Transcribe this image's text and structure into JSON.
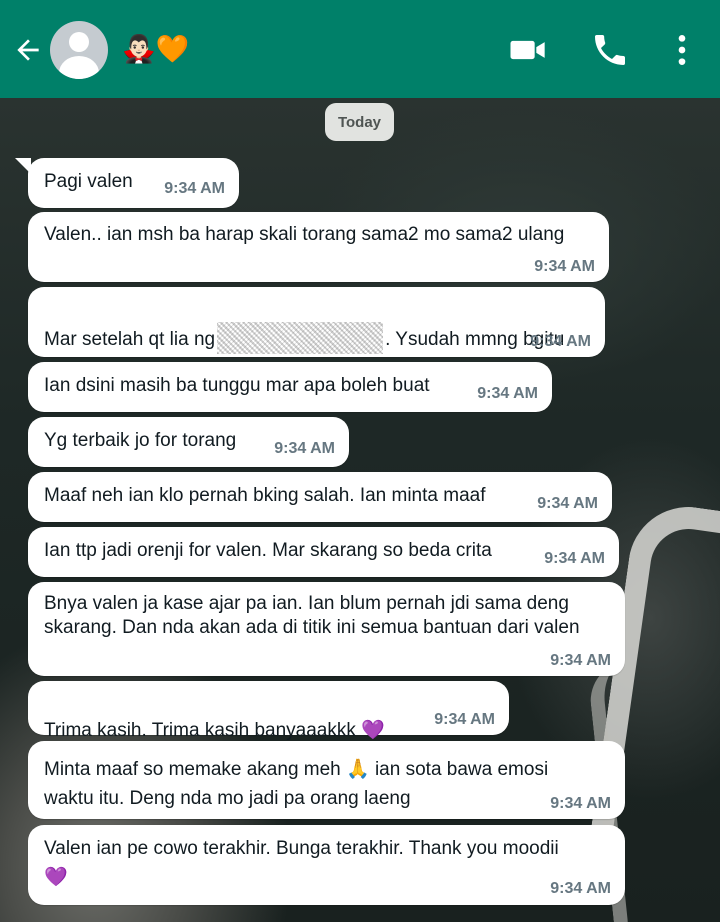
{
  "header": {
    "contact_name": "🧛🏻‍♂️🧡",
    "icons": [
      "back-arrow-icon",
      "avatar",
      "video-call-icon",
      "phone-call-icon",
      "more-options-icon"
    ],
    "brand_color": "#008069"
  },
  "date_chip": "Today",
  "messages": [
    {
      "text": "Pagi valen",
      "time": "9:34 AM"
    },
    {
      "text": "Valen.. ian msh ba harap skali torang sama2 mo sama2 ulang",
      "time": "9:34 AM"
    },
    {
      "text_before": "Mar setelah qt lia ng",
      "text_after": ". Ysudah mmng bgitu",
      "time": "9:34 AM"
    },
    {
      "text": "Ian dsini masih ba tunggu mar apa boleh buat",
      "time": "9:34 AM"
    },
    {
      "text": "Yg terbaik jo for torang",
      "time": "9:34 AM"
    },
    {
      "text": "Maaf neh ian klo pernah bking salah. Ian minta maaf",
      "time": "9:34 AM"
    },
    {
      "text": "Ian ttp jadi orenji for valen. Mar skarang so beda crita",
      "time": "9:34 AM"
    },
    {
      "text": "Bnya valen ja kase ajar pa ian. Ian blum pernah jdi sama deng\nskarang. Dan nda akan ada di titik ini semua bantuan dari valen",
      "time": "9:34 AM"
    },
    {
      "text": "Trima kasih. Trima kasih banyaaakkk 💜",
      "time": "9:34 AM"
    },
    {
      "text": "Minta maaf so memake akang meh 🙏 ian sota bawa emosi\nwaktu itu. Deng nda mo jadi pa orang laeng",
      "time": "9:34 AM"
    },
    {
      "text": "Valen ian pe cowo terakhir. Bunga terakhir. Thank you moodii\n💜",
      "time": "9:34 AM"
    }
  ]
}
